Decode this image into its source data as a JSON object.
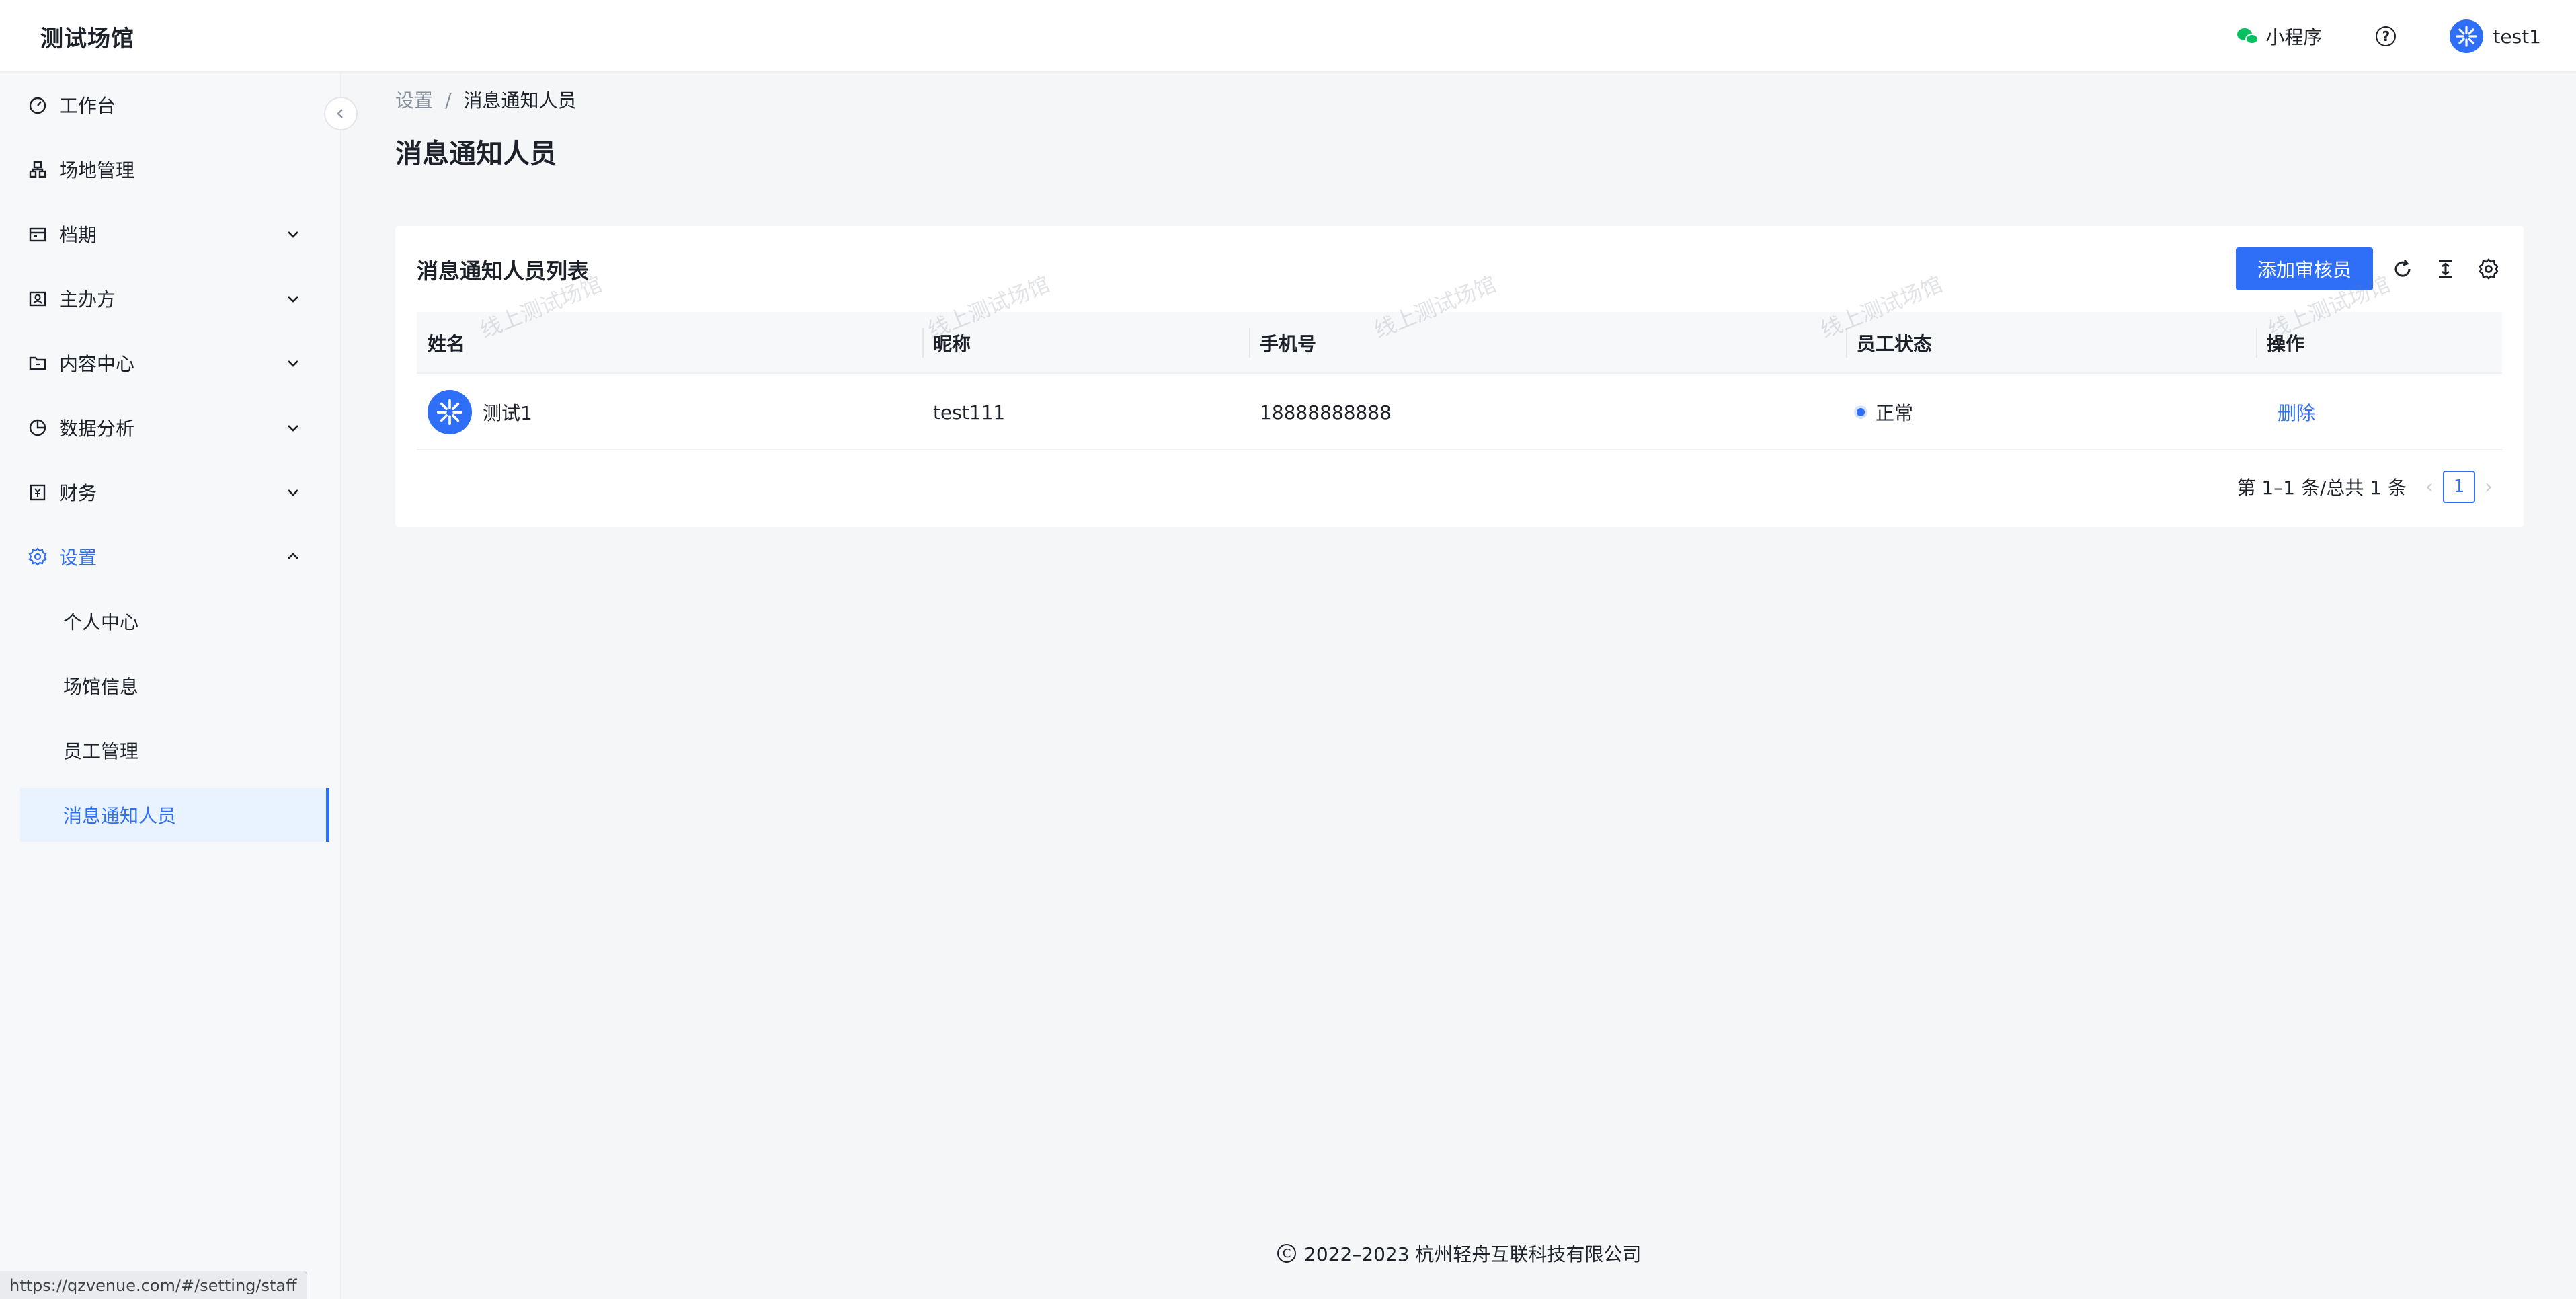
{
  "header": {
    "logo": "测试场馆",
    "mini_program_label": "小程序",
    "user_name": "test1"
  },
  "sidebar": {
    "items": [
      {
        "label": "工作台",
        "icon": "dashboard-icon"
      },
      {
        "label": "场地管理",
        "icon": "venue-icon"
      },
      {
        "label": "档期",
        "icon": "calendar-icon"
      },
      {
        "label": "主办方",
        "icon": "organizer-icon"
      },
      {
        "label": "内容中心",
        "icon": "folder-icon"
      },
      {
        "label": "数据分析",
        "icon": "pie-chart-icon"
      },
      {
        "label": "财务",
        "icon": "finance-icon"
      },
      {
        "label": "设置",
        "icon": "gear-icon"
      }
    ],
    "settings_sub_items": [
      {
        "label": "个人中心"
      },
      {
        "label": "场馆信息"
      },
      {
        "label": "员工管理"
      },
      {
        "label": "消息通知人员"
      }
    ]
  },
  "breadcrumb": {
    "parent": "设置",
    "separator": "/",
    "current": "消息通知人员"
  },
  "page_title": "消息通知人员",
  "card": {
    "title": "消息通知人员列表",
    "add_button": "添加审核员"
  },
  "table": {
    "columns": [
      "姓名",
      "昵称",
      "手机号",
      "员工状态",
      "操作"
    ],
    "rows": [
      {
        "name": "测试1",
        "nickname": "test111",
        "phone": "18888888888",
        "status": "正常",
        "action": "删除"
      }
    ]
  },
  "pagination": {
    "summary": "第 1–1 条/总共 1 条",
    "page": "1"
  },
  "watermark": "线上测试场馆",
  "footer": {
    "text": "2022–2023 杭州轻舟互联科技有限公司"
  },
  "status_bar": {
    "url": "https://qzvenue.com/#/setting/staff"
  },
  "colors": {
    "primary": "#2f6ef6",
    "sidebar_bg": "#f7f8fa",
    "active_bg": "#e8f3ff",
    "wechat_green": "#07c160"
  }
}
